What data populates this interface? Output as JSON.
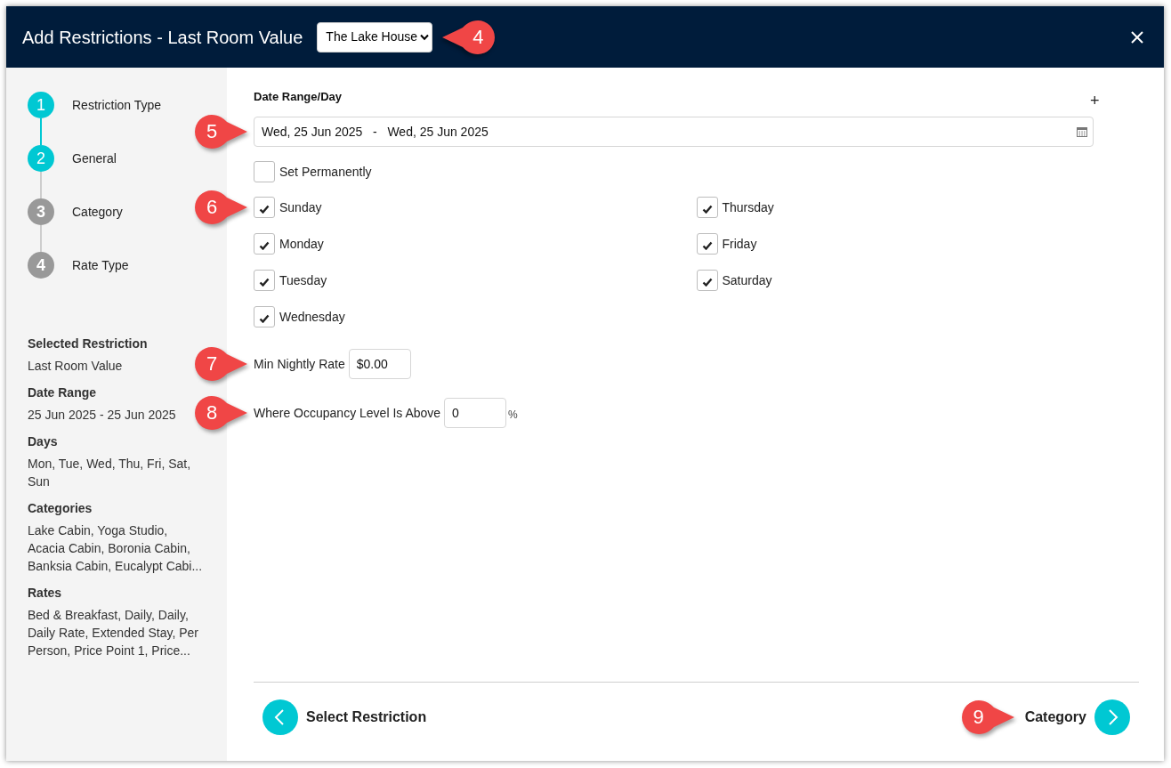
{
  "window": {
    "title": "Add Restrictions - Last Room Value"
  },
  "property_select": {
    "value": "The Lake House",
    "callout": "4"
  },
  "steps": [
    {
      "number": "1",
      "label": "Restriction Type",
      "completed": true
    },
    {
      "number": "2",
      "label": "General",
      "completed": true
    },
    {
      "number": "3",
      "label": "Category",
      "completed": false
    },
    {
      "number": "4",
      "label": "Rate Type",
      "completed": false
    }
  ],
  "summary": [
    {
      "heading": "Selected Restriction",
      "value": "Last Room Value"
    },
    {
      "heading": "Date Range",
      "value": "25 Jun 2025 - 25 Jun 2025"
    },
    {
      "heading": "Days",
      "value": "Mon, Tue, Wed, Thu, Fri, Sat, Sun"
    },
    {
      "heading": "Categories",
      "value": "Lake Cabin, Yoga Studio, Acacia Cabin, Boronia Cabin, Banksia Cabin, Eucalypt Cabi..."
    },
    {
      "heading": "Rates",
      "value": "Bed & Breakfast, Daily, Daily, Daily Rate, Extended Stay, Per Person, Price Point 1, Price..."
    }
  ],
  "form": {
    "heading": "Date Range/Day",
    "add_button": "+",
    "date_range": {
      "value": "Wed, 25 Jun 2025   -   Wed, 25 Jun 2025",
      "callout": "5"
    },
    "set_permanently": {
      "label": "Set Permanently",
      "checked": false
    },
    "days": {
      "callout": "6",
      "items": [
        {
          "label": "Sunday",
          "checked": true
        },
        {
          "label": "Monday",
          "checked": true
        },
        {
          "label": "Tuesday",
          "checked": true
        },
        {
          "label": "Wednesday",
          "checked": true
        },
        {
          "label": "Thursday",
          "checked": true
        },
        {
          "label": "Friday",
          "checked": true
        },
        {
          "label": "Saturday",
          "checked": true
        }
      ]
    },
    "min_nightly_rate": {
      "label": "Min Nightly Rate",
      "value": "$0.00",
      "callout": "7"
    },
    "occupancy_level": {
      "label": "Where Occupancy Level Is Above",
      "value": "0",
      "unit": "%",
      "callout": "8"
    }
  },
  "footer": {
    "back_button": {
      "label": "Select Restriction"
    },
    "next_button": {
      "label": "Category",
      "callout": "9"
    }
  }
}
